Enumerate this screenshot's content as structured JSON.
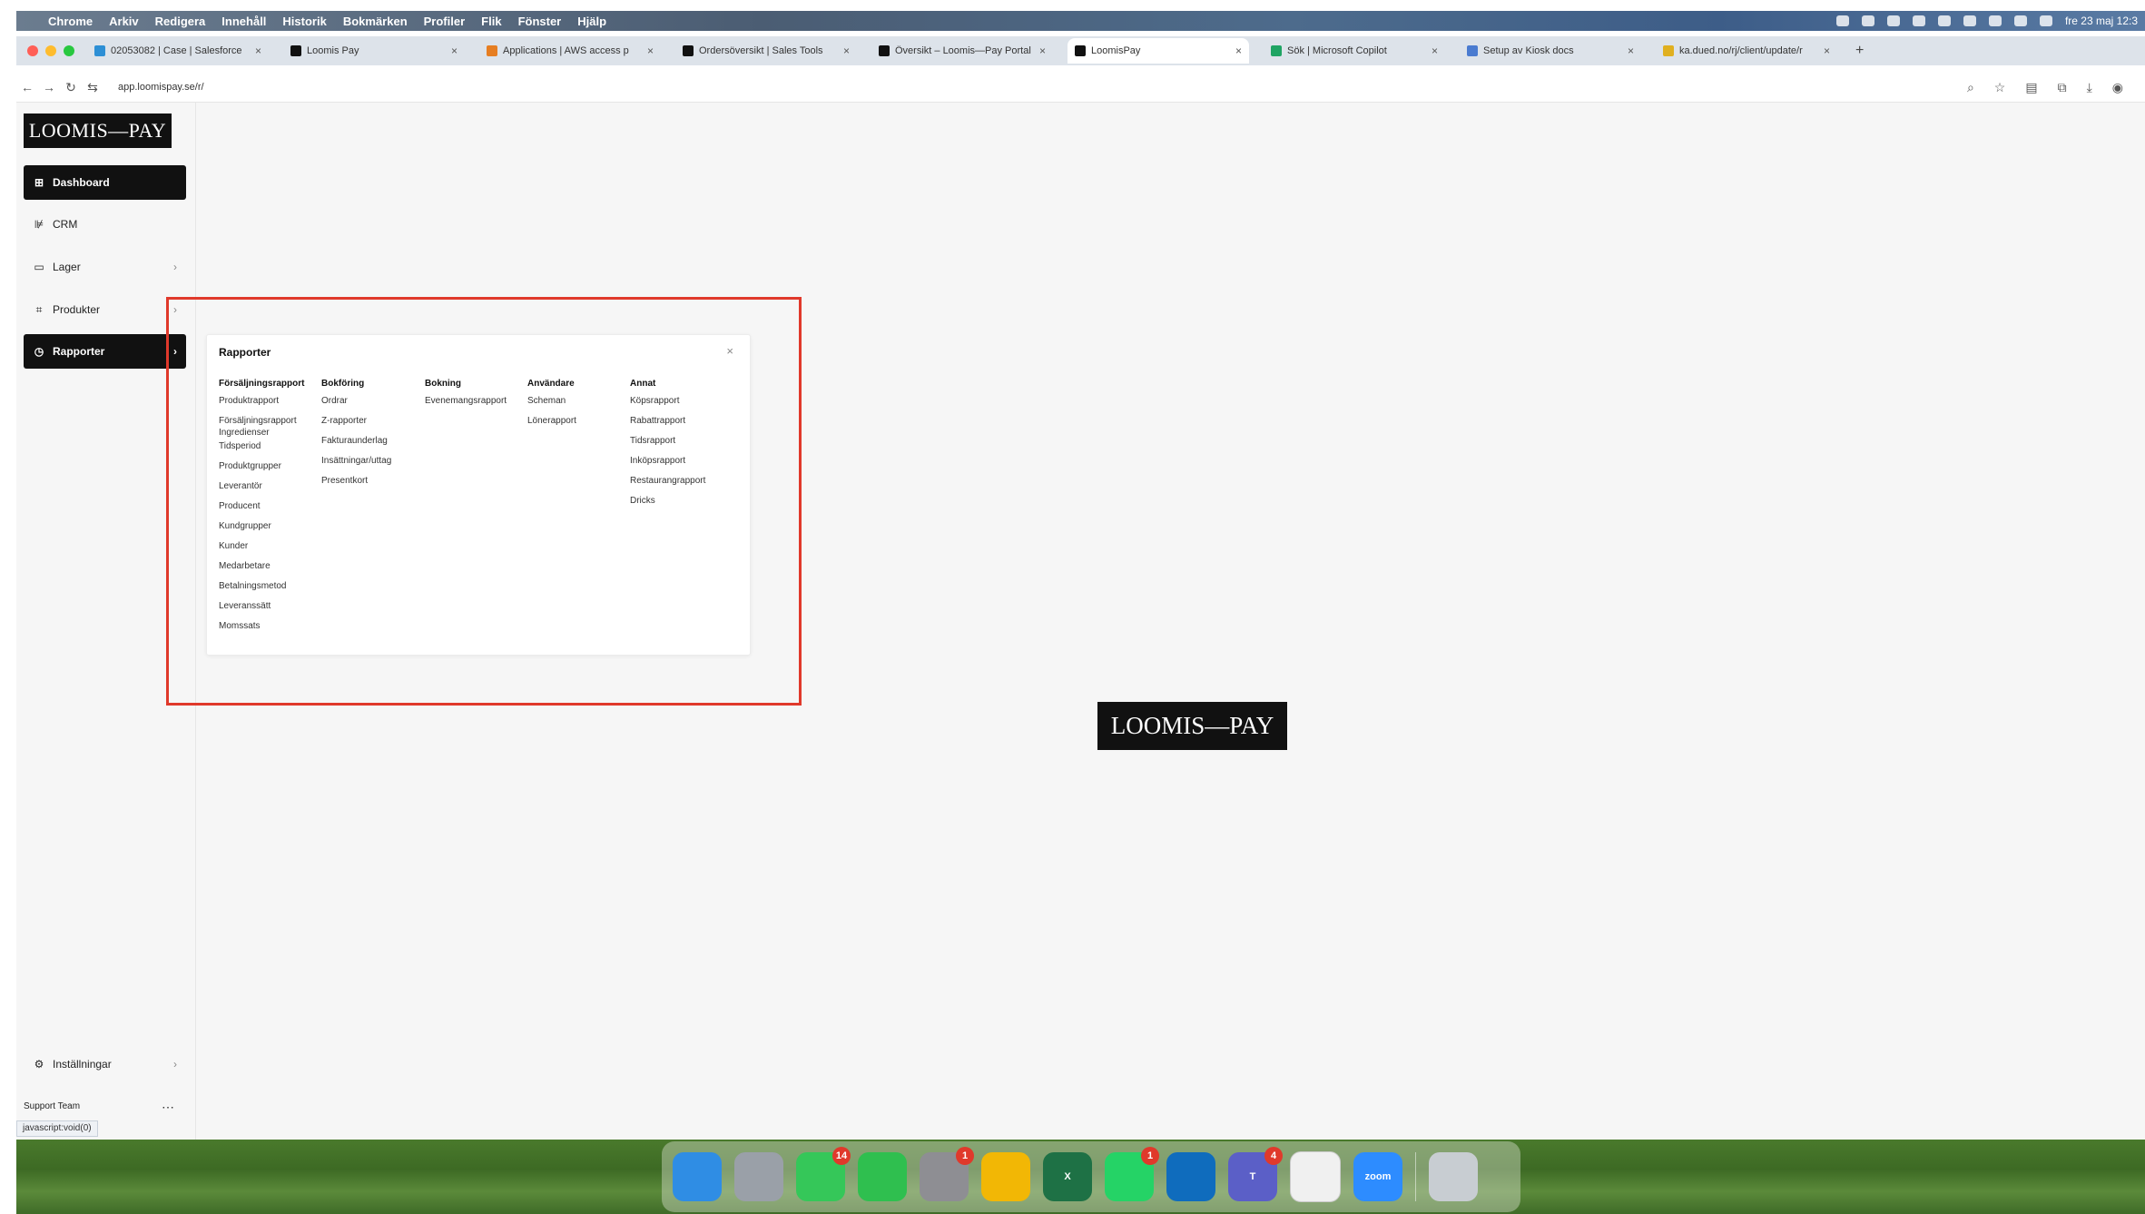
{
  "menubar": {
    "items": [
      "Chrome",
      "Arkiv",
      "Redigera",
      "Innehåll",
      "Historik",
      "Bokmärken",
      "Profiler",
      "Flik",
      "Fönster",
      "Hjälp"
    ],
    "clock": "fre 23 maj 12:3"
  },
  "tabs": [
    {
      "title": "02053082 | Case | Salesforce",
      "color": "#2d8fd5"
    },
    {
      "title": "Loomis Pay",
      "color": "#111111"
    },
    {
      "title": "Applications | AWS access p",
      "color": "#e67e22"
    },
    {
      "title": "Ordersöversikt | Sales Tools",
      "color": "#111111"
    },
    {
      "title": "Översikt – Loomis—Pay Portal",
      "color": "#111111"
    },
    {
      "title": "LoomisPay",
      "color": "#111111",
      "active": true
    },
    {
      "title": "Sök | Microsoft Copilot",
      "color": "#1fa463"
    },
    {
      "title": "Setup av Kiosk docs",
      "color": "#4a7bd0"
    },
    {
      "title": "ka.dued.no/rj/client/update/r",
      "color": "#e0b020"
    }
  ],
  "address": {
    "url": "app.loomispay.se/r/"
  },
  "sidebar": {
    "logo": "LOOMIS—PAY",
    "items": [
      {
        "label": "Dashboard",
        "icon": "grid-icon",
        "glyph": "⊞"
      },
      {
        "label": "CRM",
        "icon": "chart-icon",
        "glyph": "⊯"
      },
      {
        "label": "Lager",
        "icon": "box-icon",
        "glyph": "▭"
      },
      {
        "label": "Produkter",
        "icon": "scan-icon",
        "glyph": "⌗"
      },
      {
        "label": "Rapporter",
        "icon": "clock-icon",
        "glyph": "◷"
      }
    ],
    "settings_label": "Inställningar",
    "support_label": "Support Team",
    "url_tooltip": "javascript:void(0)"
  },
  "popover": {
    "title": "Rapporter",
    "columns": [
      {
        "heading": "Försäljningsrapport",
        "items": [
          "Produktrapport",
          "Försäljningsrapport Ingredienser",
          "Tidsperiod",
          "Produktgrupper",
          "Leverantör",
          "Producent",
          "Kundgrupper",
          "Kunder",
          "Medarbetare",
          "Betalningsmetod",
          "Leveranssätt",
          "Momssats"
        ]
      },
      {
        "heading": "Bokföring",
        "items": [
          "Ordrar",
          "Z-rapporter",
          "Fakturaunderlag",
          "Insättningar/uttag",
          "Presentkort"
        ]
      },
      {
        "heading": "Bokning",
        "items": [
          "Evenemangsrapport"
        ]
      },
      {
        "heading": "Användare",
        "items": [
          "Scheman",
          "Lönerapport"
        ]
      },
      {
        "heading": "Annat",
        "items": [
          "Köpsrapport",
          "Rabattrapport",
          "Tidsrapport",
          "Inköpsrapport",
          "Restaurangrapport",
          "Dricks"
        ]
      }
    ]
  },
  "main": {
    "center_logo": "LOOMIS—PAY"
  },
  "dock": {
    "apps": [
      {
        "name": "finder",
        "color": "#2f8de4",
        "label": ""
      },
      {
        "name": "launchpad",
        "color": "#9aa0a8",
        "label": ""
      },
      {
        "name": "messages",
        "color": "#35c759",
        "label": "",
        "badge": "14"
      },
      {
        "name": "facetime",
        "color": "#2fbf4f",
        "label": ""
      },
      {
        "name": "system-settings",
        "color": "#8e8e93",
        "label": "",
        "badge": "1"
      },
      {
        "name": "chrome",
        "color": "#f2b705",
        "label": ""
      },
      {
        "name": "excel",
        "color": "#1e7145",
        "label": "X"
      },
      {
        "name": "whatsapp",
        "color": "#25d366",
        "label": "",
        "badge": "1"
      },
      {
        "name": "outlook",
        "color": "#0f6cbd",
        "label": ""
      },
      {
        "name": "teams",
        "color": "#5b5fc7",
        "label": "T",
        "badge": "4"
      },
      {
        "name": "notes",
        "color": "#f0f0f0",
        "label": ""
      },
      {
        "name": "zoom",
        "color": "#2d8cff",
        "label": "zoom"
      },
      {
        "name": "trash",
        "color": "#c8cdd2",
        "label": ""
      }
    ]
  }
}
